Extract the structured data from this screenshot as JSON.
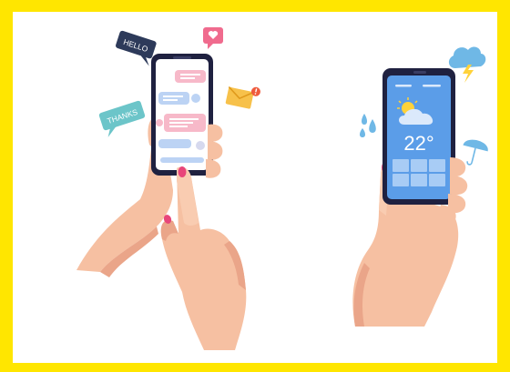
{
  "illustration": {
    "left_scene": {
      "bubbles": {
        "hello": "HELLO",
        "thanks": "THANKS"
      }
    },
    "right_scene": {
      "temperature": "22°"
    }
  },
  "colors": {
    "frame": "#ffe600",
    "skin": "#f6c0a2",
    "skin_shadow": "#eaa589",
    "nail": "#e8457a",
    "phone_body": "#1f2140",
    "chat_pink": "#f7b9c9",
    "chat_blue": "#bcd3f4",
    "weather_bg": "#5b9de8",
    "weather_dark": "#3f7fd6",
    "hello_bubble": "#2d3a5a",
    "thanks_bubble": "#6cc5c9",
    "heart": "#f06b8e",
    "mail": "#f7c14a",
    "rain": "#6fb8e6",
    "sun": "#ffd23a"
  }
}
